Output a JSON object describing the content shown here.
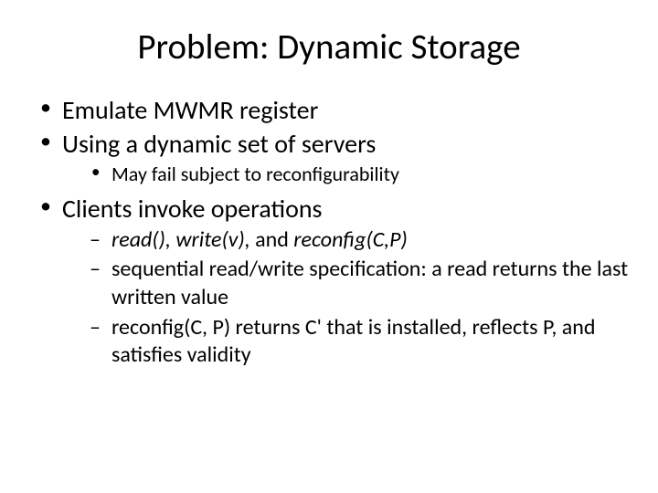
{
  "title": "Problem: Dynamic Storage",
  "b1": "Emulate MWMR register",
  "b2": "Using a dynamic set of servers",
  "b2a": "May fail subject to reconfigurability",
  "b3": "Clients invoke operations",
  "b3a_i1": " read(), write(v), ",
  "b3a_and": "and ",
  "b3a_i2": "reconfig(C,P)",
  "b3b": "sequential read/write specification: a read returns the last written value",
  "b3c": "reconfig(C, P) returns C' that is installed, reflects P, and satisfies validity"
}
